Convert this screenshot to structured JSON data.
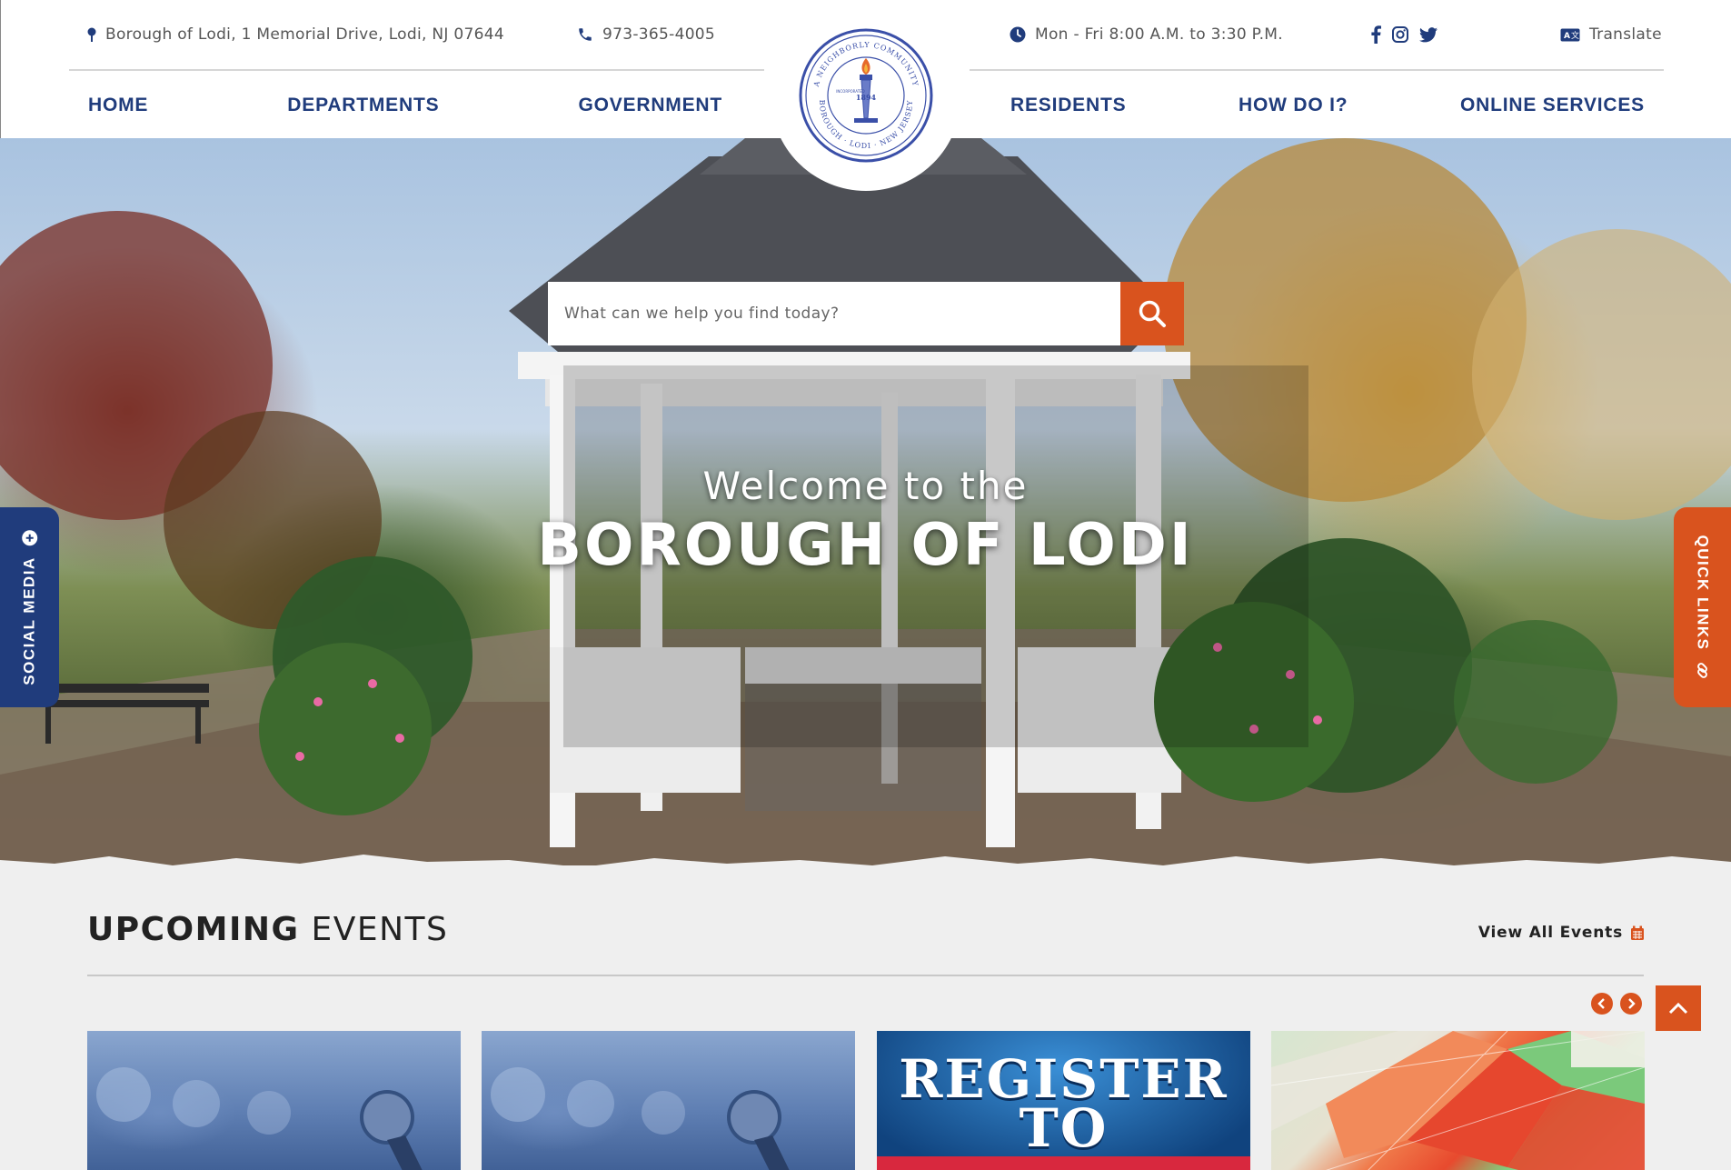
{
  "header": {
    "address": "Borough of Lodi, 1 Memorial Drive, Lodi, NJ 07644",
    "phone": "973-365-4005",
    "hours": "Mon - Fri 8:00 A.M. to 3:30 P.M.",
    "translate": "Translate",
    "socials": [
      "facebook-icon",
      "instagram-icon",
      "twitter-icon"
    ],
    "seal": {
      "top_text": "A NEIGHBORLY COMMUNITY",
      "year": "1894",
      "incorporated": "INCORPORATED",
      "bottom_text": "BOROUGH · LODI · NEW JERSEY"
    }
  },
  "nav": {
    "left": [
      "HOME",
      "DEPARTMENTS",
      "GOVERNMENT"
    ],
    "right": [
      "RESIDENTS",
      "HOW DO I?",
      "ONLINE SERVICES"
    ]
  },
  "hero": {
    "search_placeholder": "What can we help you find today?",
    "welcome_small": "Welcome to the",
    "welcome_big": "BOROUGH OF LODI"
  },
  "side_tabs": {
    "social": "SOCIAL MEDIA",
    "quick": "QUICK LINKS"
  },
  "events": {
    "title_bold": "UPCOMING",
    "title_rest": "EVENTS",
    "view_all": "View All Events",
    "card_vote_line1": "REGISTER",
    "card_vote_line2": "TO"
  },
  "colors": {
    "brand_blue": "#203c7c",
    "accent_orange": "#d9531e"
  }
}
